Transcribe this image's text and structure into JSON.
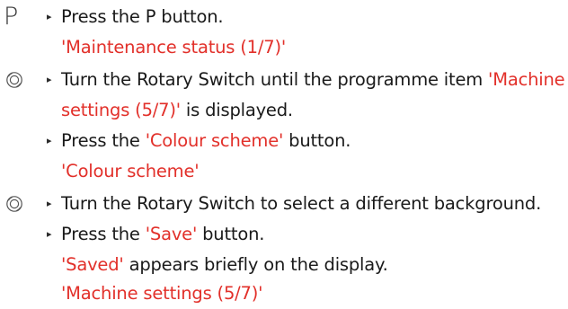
{
  "steps": [
    {
      "symbol": "P",
      "parts": [
        "Press the P button."
      ]
    },
    {
      "display": "'Maintenance status (1/7)'"
    },
    {
      "symbol": "rotary-switch-icon",
      "parts": [
        "Turn the Rotary Switch until the programme item ",
        "'Machine",
        ""
      ]
    },
    {
      "continuation": [
        "settings (5/7)'",
        " is displayed."
      ]
    },
    {
      "parts": [
        "Press the ",
        "'Colour scheme'",
        " button."
      ]
    },
    {
      "display": "'Colour scheme'"
    },
    {
      "symbol": "rotary-switch-icon",
      "parts": [
        "Turn the Rotary Switch to select a different background."
      ]
    },
    {
      "parts": [
        "Press the ",
        "'Save'",
        " button."
      ]
    },
    {
      "continuation": [
        "'Saved'",
        " appears briefly on the display."
      ]
    },
    {
      "display": "'Machine settings (5/7)'"
    }
  ],
  "arrow_glyph": "▸",
  "colors": {
    "highlight": "#e2302a",
    "text": "#1a1a1a"
  }
}
